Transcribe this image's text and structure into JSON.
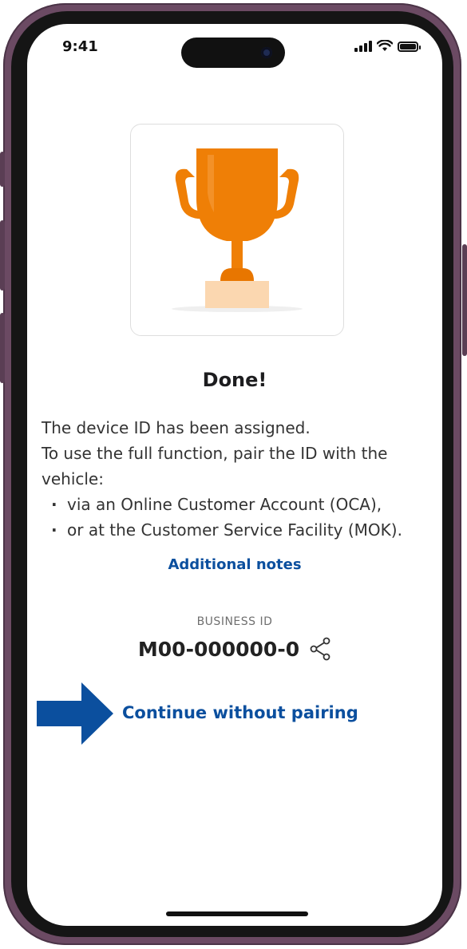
{
  "status_bar": {
    "time": "9:41"
  },
  "screen": {
    "title": "Done!",
    "body_lines": [
      "The device ID has been assigned.",
      "To use the full function, pair the ID with the vehicle:"
    ],
    "bullets": [
      "via an Online Customer Account (OCA),",
      "or at the Customer Service Facility (MOK)."
    ],
    "additional_notes_link": "Additional notes",
    "business_id_label": "BUSINESS ID",
    "business_id_value": "M00-000000-0",
    "continue_link": "Continue without pairing"
  },
  "colors": {
    "link": "#0b4f9e",
    "trophy": "#ef7f06",
    "trophy_base": "#fbd7b0",
    "arrow": "#0b4f9e",
    "phone_frame": "#6b4a63"
  },
  "icons": {
    "trophy": "trophy-icon",
    "share": "share-icon",
    "arrow": "arrow-right-icon"
  }
}
